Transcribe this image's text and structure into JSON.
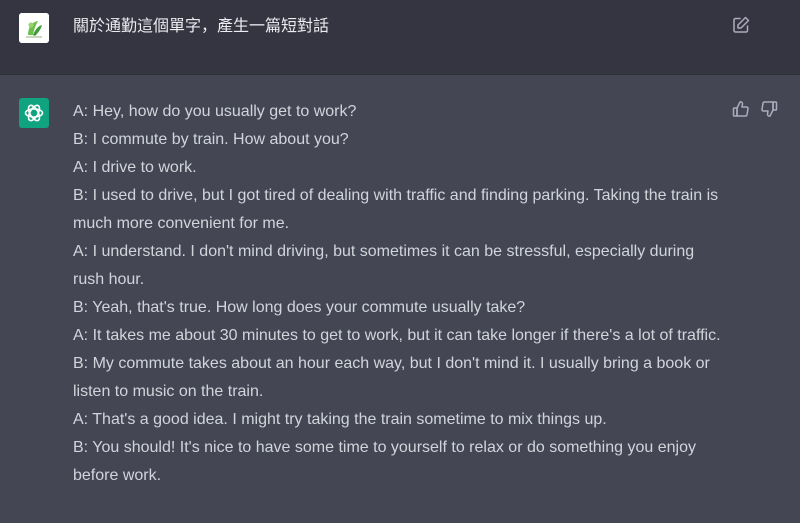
{
  "user_message": {
    "text": "關於通勤這個單字，產生一篇短對話",
    "avatar_icon": "user-avatar-image",
    "edit_icon": "edit-icon"
  },
  "assistant_message": {
    "avatar_icon": "openai-logo-icon",
    "lines": [
      "A: Hey, how do you usually get to work?",
      "B: I commute by train. How about you?",
      "A: I drive to work.",
      "B: I used to drive, but I got tired of dealing with traffic and finding parking. Taking the train is much more convenient for me.",
      "A: I understand. I don't mind driving, but sometimes it can be stressful, especially during rush hour.",
      "B: Yeah, that's true. How long does your commute usually take?",
      "A: It takes me about 30 minutes to get to work, but it can take longer if there's a lot of traffic.",
      "B: My commute takes about an hour each way, but I don't mind it. I usually bring a book or listen to music on the train.",
      "A: That's a good idea. I might try taking the train sometime to mix things up.",
      "B: You should! It's nice to have some time to yourself to relax or do something you enjoy before work."
    ],
    "feedback_icons": [
      "thumbs-up-icon",
      "thumbs-down-icon"
    ]
  },
  "colors": {
    "user_row_bg": "#343541",
    "assistant_row_bg": "#444654",
    "accent": "#10a37f",
    "text": "#d1d5db"
  }
}
